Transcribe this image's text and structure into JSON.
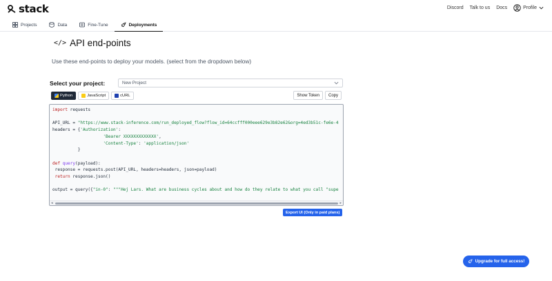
{
  "brand": {
    "name": "stack"
  },
  "topnav": {
    "discord": "Discord",
    "talk": "Talk to us",
    "docs": "Docs",
    "profile": "Profile"
  },
  "tabs": [
    {
      "label": "Projects",
      "icon": "grid-icon"
    },
    {
      "label": "Data",
      "icon": "database-icon"
    },
    {
      "label": "Fine-Tune",
      "icon": "tune-icon"
    },
    {
      "label": "Deployments",
      "icon": "rocket-icon",
      "active": true
    }
  ],
  "main": {
    "title": "API end-points",
    "description": "Use these end-points to deploy your models. (select from the dropdown below)",
    "project_label": "Select your project:",
    "project_selected": "New Project",
    "languages": [
      "Python",
      "JavaScript",
      "cURL"
    ],
    "show_token": "Show Token",
    "copy": "Copy",
    "export": "Export UI (Only in paid plans)",
    "upgrade": "Upgrade for full access!"
  },
  "code": {
    "l1_kw": "import",
    "l1_rest": " requests",
    "l3_a": "API_URL = ",
    "l3_str": "\"https://www.stack-inference.com/run_deployed_flow?flow_id=64ccfff000eee629e3b82e62&org=4ed3b51c-fe6e-4",
    "l4_a": "headers = {",
    "l4_str": "'Authorization'",
    "l4_b": ":",
    "l5_str": "'Bearer XXXXXXXXXXXXX'",
    "l5_b": ",",
    "l6_str1": "'Content-Type'",
    "l6_b": ": ",
    "l6_str2": "'application/json'",
    "l7": "}",
    "l9_kw": "def",
    "l9_fn": " query",
    "l9_rest": "(payload):",
    "l10": " response = requests.post(API_URL, headers=headers, json=payload)",
    "l11_kw": " return",
    "l11_rest": " response.json()",
    "l13_a": "output = query({",
    "l13_str1": "\"in-0\"",
    "l13_b": ": ",
    "l13_str2": "\"\"\"Hej Lars. What are business cycles about and how do they relate to what you call \"supe"
  },
  "colors": {
    "accent": "#2563eb",
    "dark": "#1f2937"
  }
}
